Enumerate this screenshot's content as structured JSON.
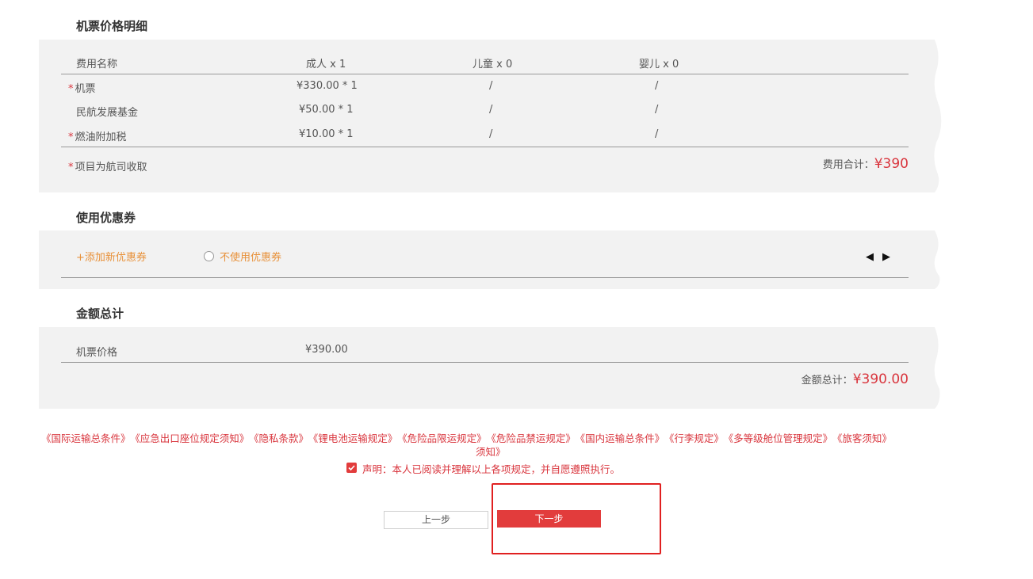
{
  "price_detail": {
    "title": "机票价格明细",
    "headers": [
      "费用名称",
      "成人 x 1",
      "儿童 x 0",
      "婴儿 x 0"
    ],
    "rows": [
      {
        "star": "*",
        "name": "机票",
        "adult": "¥330.00 * 1",
        "child": "/",
        "infant": "/"
      },
      {
        "star": "",
        "name": "民航发展基金",
        "adult": "¥50.00 * 1",
        "child": "/",
        "infant": "/"
      },
      {
        "star": "*",
        "name": "燃油附加税",
        "adult": "¥10.00 * 1",
        "child": "/",
        "infant": "/"
      }
    ],
    "note_star": "*",
    "note": "项目为航司收取",
    "subtotal_label": "费用合计：",
    "subtotal_value": "¥390"
  },
  "coupon": {
    "title": "使用优惠券",
    "add_label": "+添加新优惠券",
    "no_coupon_label": "不使用优惠券",
    "prev_arrow": "◀",
    "next_arrow": "▶"
  },
  "total": {
    "title": "金额总计",
    "ticket_label": "机票价格",
    "ticket_value": "¥390.00",
    "total_label": "金额总计：",
    "total_value": "¥390.00"
  },
  "links": [
    "《国际运输总条件》",
    "《应急出口座位规定须知》",
    "《隐私条款》",
    "《锂电池运输规定》",
    "《危险品限运规定》",
    "《危险品禁运规定》",
    "《国内运输总条件》",
    "《行李规定》",
    "《多等级舱位管理规定》",
    "《旅客须知》"
  ],
  "links_wrap": "须知》",
  "declaration": "声明：本人已阅读并理解以上各项规定，并自愿遵照执行。",
  "buttons": {
    "prev": "上一步",
    "next": "下一步"
  },
  "colors": {
    "accent_red": "#e23c3c",
    "orange": "#e8913a",
    "panel_bg": "#f2f2f2"
  }
}
